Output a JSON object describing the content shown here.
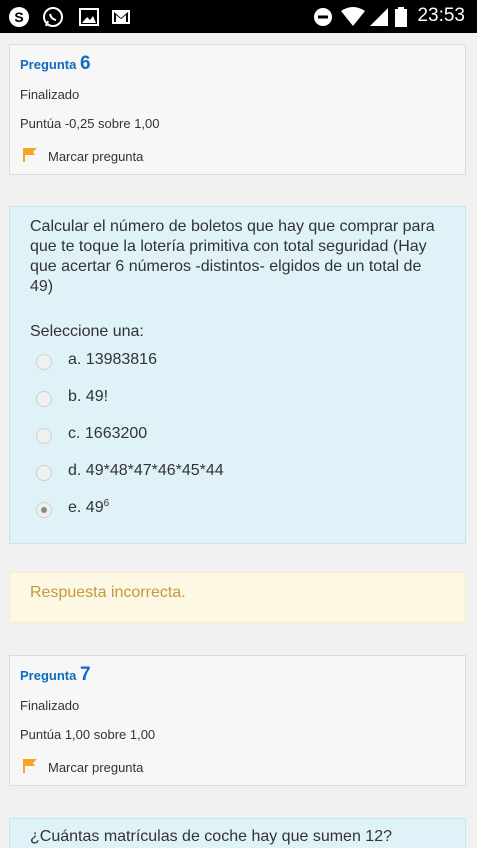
{
  "status_bar": {
    "time": "23:53",
    "left_icons": [
      "skype-icon",
      "whatsapp-icon",
      "image-icon",
      "gmail-icon"
    ],
    "right_icons": [
      "do-not-disturb-icon",
      "wifi-icon",
      "signal-icon",
      "battery-icon"
    ]
  },
  "questions": [
    {
      "title_prefix": "Pregunta",
      "number": "6",
      "status": "Finalizado",
      "score": "Puntúa -0,25 sobre 1,00",
      "flag_label": "Marcar pregunta",
      "text": "Calcular el número de boletos que hay que comprar para que te toque la lotería primitiva con total seguridad (Hay que acertar 6 números -distintos- elgidos de un total de 49)",
      "prompt": "Seleccione una:",
      "options": [
        {
          "label": "a. 13983816",
          "selected": false
        },
        {
          "label": "b. 49!",
          "selected": false
        },
        {
          "label": "c. 1663200",
          "selected": false
        },
        {
          "label": "d. 49*48*47*46*45*44",
          "selected": false
        },
        {
          "label": "e. 49",
          "sup": "6",
          "selected": true
        }
      ],
      "feedback": "Respuesta incorrecta."
    },
    {
      "title_prefix": "Pregunta",
      "number": "7",
      "status": "Finalizado",
      "score": "Puntúa 1,00 sobre 1,00",
      "flag_label": "Marcar pregunta",
      "text": "¿Cuántas matrículas de coche hay que sumen 12?"
    }
  ],
  "colors": {
    "title_blue": "#0f6cbf",
    "question_bg": "#def2f8",
    "feedback_bg": "#fcf8e3",
    "feedback_text": "#c49a3a",
    "flag_orange": "#f5a623"
  }
}
